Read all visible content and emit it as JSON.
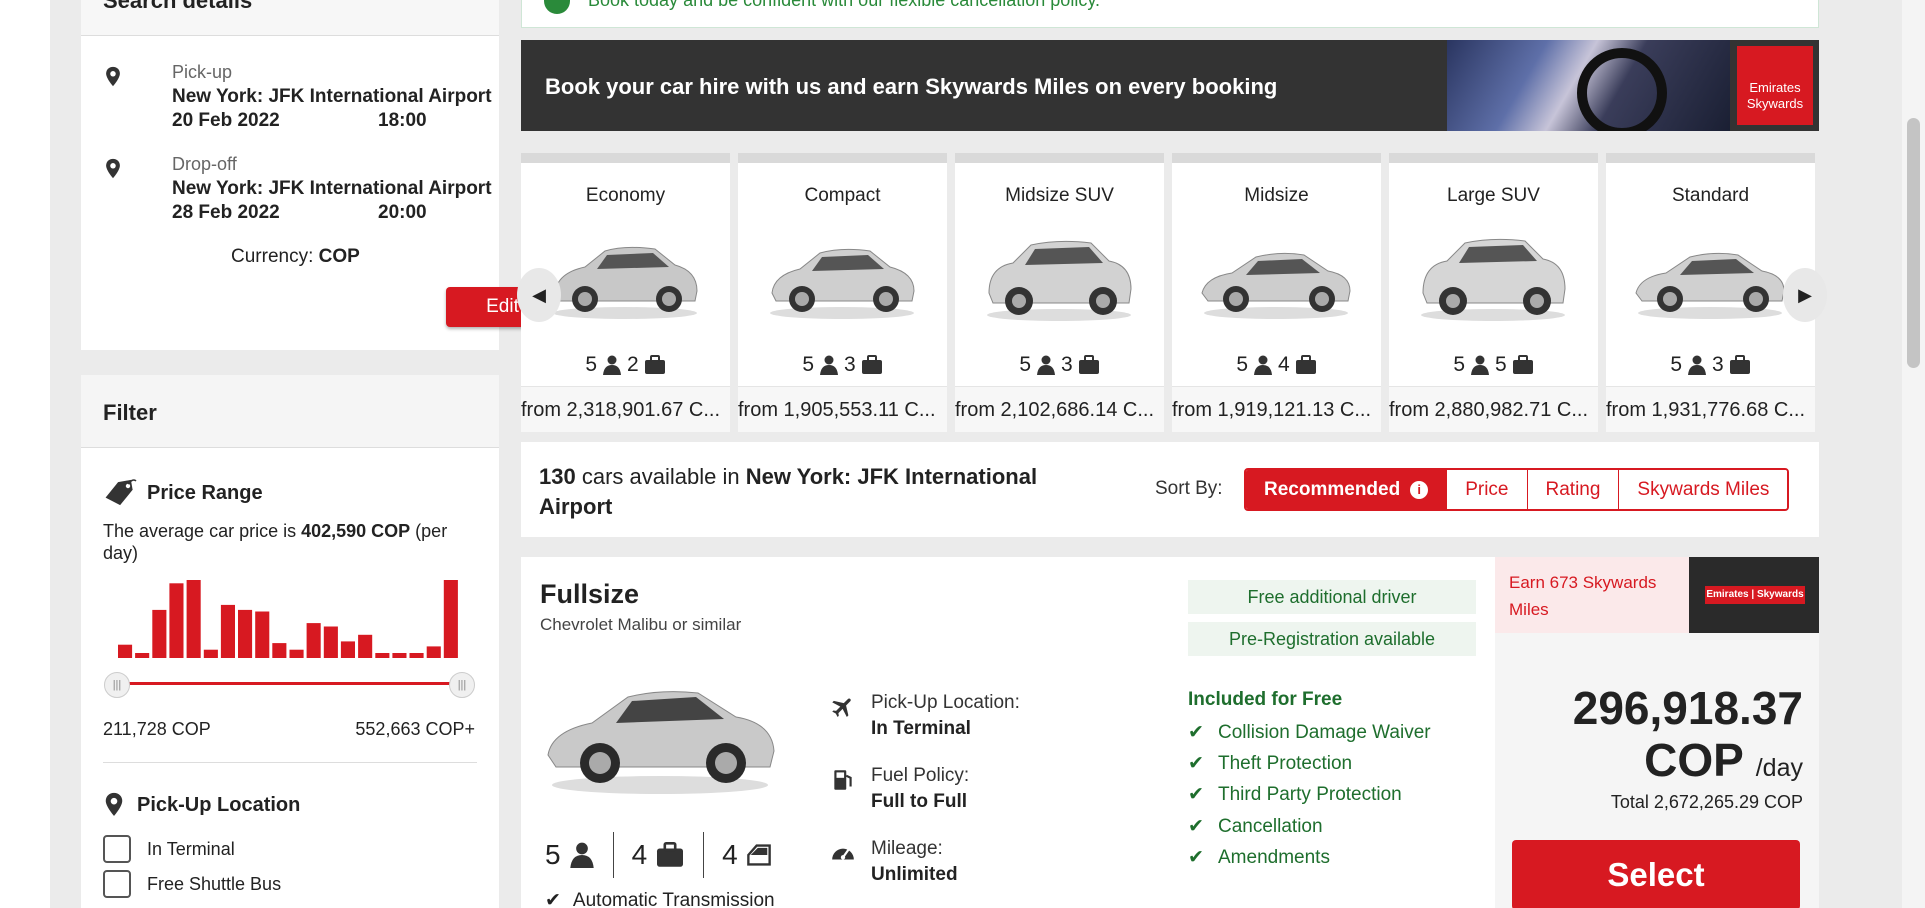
{
  "search": {
    "title": "Search details",
    "pickup": {
      "label": "Pick-up",
      "location": "New York: JFK International Airport",
      "date": "20 Feb 2022",
      "time": "18:00"
    },
    "dropoff": {
      "label": "Drop-off",
      "location": "New York: JFK International Airport",
      "date": "28 Feb 2022",
      "time": "20:00"
    },
    "currency_label": "Currency:",
    "currency_value": "COP",
    "edit_label": "Edit"
  },
  "filter": {
    "title": "Filter",
    "price_range": {
      "title": "Price Range",
      "desc_prefix": "The average car price is ",
      "avg": "402,590 COP",
      "desc_suffix": " (per day)",
      "min": "211,728 COP",
      "max": "552,663 COP+",
      "histogram": [
        8,
        3,
        29,
        45,
        47,
        5,
        32,
        29,
        28,
        9,
        5,
        21,
        19,
        10,
        14,
        3,
        3,
        3,
        7,
        47
      ]
    },
    "pickup_location": {
      "title": "Pick-Up Location",
      "options": [
        "In Terminal",
        "Free Shuttle Bus"
      ]
    }
  },
  "notice": "Book today and be confident with our flexible cancellation policy.",
  "banner": {
    "text": "Book your car hire with us and earn Skywards Miles on every booking",
    "logo_line1": "Emirates",
    "logo_line2": "Skywards"
  },
  "categories": [
    {
      "name": "Economy",
      "seats": "5",
      "bags": "2",
      "price": "from 2,318,901.67 C..."
    },
    {
      "name": "Compact",
      "seats": "5",
      "bags": "3",
      "price": "from 1,905,553.11 C..."
    },
    {
      "name": "Midsize SUV",
      "seats": "5",
      "bags": "3",
      "price": "from 2,102,686.14 C..."
    },
    {
      "name": "Midsize",
      "seats": "5",
      "bags": "4",
      "price": "from 1,919,121.13 C..."
    },
    {
      "name": "Large SUV",
      "seats": "5",
      "bags": "5",
      "price": "from 2,880,982.71 C..."
    },
    {
      "name": "Standard",
      "seats": "5",
      "bags": "3",
      "price": "from 1,931,776.68 C..."
    }
  ],
  "availability": {
    "count": "130",
    "text": " cars available in ",
    "location": "New York: JFK International Airport"
  },
  "sort": {
    "label": "Sort By:",
    "options": [
      "Recommended",
      "Price",
      "Rating",
      "Skywards Miles"
    ],
    "active": "Recommended",
    "info_glyph": "i"
  },
  "result": {
    "class": "Fullsize",
    "model": "Chevrolet Malibu or similar",
    "seats": "5",
    "bags": "4",
    "doors": "4",
    "transmission": "Automatic Transmission",
    "pickup_location": {
      "label": "Pick-Up Location:",
      "value": "In Terminal"
    },
    "fuel_policy": {
      "label": "Fuel Policy:",
      "value": "Full to Full"
    },
    "mileage": {
      "label": "Mileage:",
      "value": "Unlimited"
    },
    "badges": [
      "Free additional driver",
      "Pre-Registration available"
    ],
    "included_title": "Included for Free",
    "included": [
      "Collision Damage Waiver",
      "Theft Protection",
      "Third Party Protection",
      "Cancellation",
      "Amendments"
    ],
    "earn_text": "Earn 673 Skywards Miles",
    "earn_logo": "Emirates | Skywards",
    "price_line1": "296,918.37",
    "price_line2": "COP",
    "per": "/day",
    "total": "Total 2,672,265.29 COP",
    "select_label": "Select"
  },
  "colors": {
    "brand_red": "#d71921",
    "green": "#1e6e2d",
    "dark_banner": "#333333"
  }
}
